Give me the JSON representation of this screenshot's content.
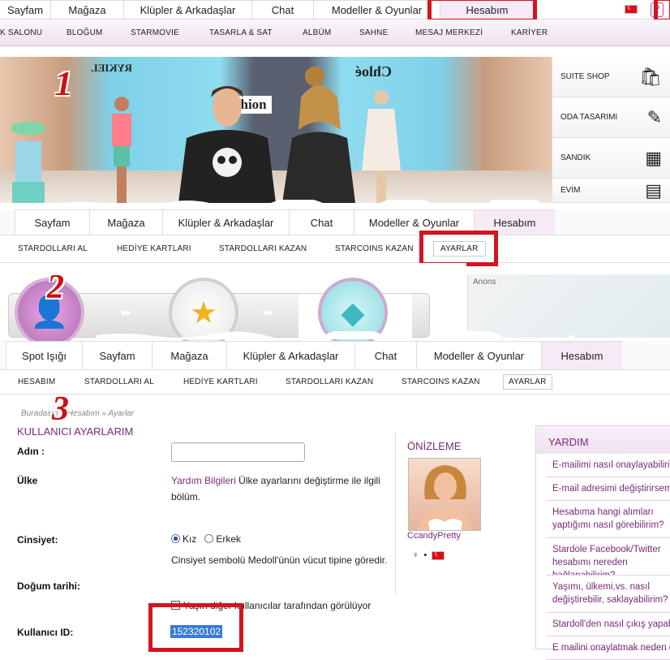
{
  "section1": {
    "tabs": [
      "Sayfam",
      "Mağaza",
      "Klüpler & Arkadaşlar",
      "Chat",
      "Modeller & Oyunlar",
      "Hesabım"
    ],
    "help_glyph": "?",
    "subnav": [
      "K SALONU",
      "BLOĞUM",
      "STARMOVIE",
      "TASARLA & SAT",
      "ALBÜM",
      "SAHNE",
      "MESAJ MERKEZİ",
      "KARİYER"
    ],
    "banner": {
      "sign_left": "RYKIEL",
      "sign_mid": "Fashion",
      "sign_right": "Chloé"
    },
    "side_menu": [
      "SUITE SHOP",
      "ODA TASARIMI",
      "SANDIK",
      "EVİM"
    ]
  },
  "section2": {
    "tabs": [
      "Sayfam",
      "Mağaza",
      "Klüpler & Arkadaşlar",
      "Chat",
      "Modeller & Oyunlar",
      "Hesabım"
    ],
    "subnav": [
      "STARDOLLARI AL",
      "HEDİYE KARTLARI",
      "STARDOLLARI KAZAN",
      "STARCOINS KAZAN",
      "AYARLAR"
    ],
    "anons": "Anons"
  },
  "section3": {
    "tabs": [
      "Spot Işığı",
      "Sayfam",
      "Mağaza",
      "Klüpler & Arkadaşlar",
      "Chat",
      "Modeller & Oyunlar",
      "Hesabım"
    ],
    "subnav": [
      "HESABIM",
      "STARDOLLARI AL",
      "HEDİYE KARTLARI",
      "STARDOLLARI KAZAN",
      "STARCOINS KAZAN",
      "AYARLAR"
    ],
    "breadcrumb": "Buradasın » Hesabım » Ayarlar",
    "title": "KULLANICI AYARLARIM",
    "fields": {
      "name_label": "Adın :",
      "country_label": "Ülke",
      "country_link": "Yardım Bilgileri",
      "country_text": "Ülke ayarlarını değiştirme ile ilgili bölüm.",
      "gender_label": "Cinsiyet:",
      "gender_female": "Kız",
      "gender_male": "Erkek",
      "gender_note": "Cinsiyet sembolü Medoll'ünün vücut tipine göredir.",
      "birth_label": "Doğum tarihi:",
      "birth_check": "Yaşın diğer kullanıcılar tarafından görülüyor",
      "uid_label": "Kullanıcı ID:",
      "uid_value": "152320102"
    },
    "preview": {
      "title": "ÖNİZLEME",
      "username": "CcandyPretty",
      "gender_symbol": "♀",
      "dot": "•"
    },
    "help": {
      "title": "YARDIM",
      "items": [
        "E-mailimi nasıl onaylayabilirim?",
        "E-mail adresimi değiştirirsem?",
        "Hesabıma hangi alımları yaptığımı nasıl görebilirim?",
        "Stardole Facebook/Twitter hesabımı nereden bağlanabilirim?",
        "Yaşımı, ülkemi,vs. nasıl değiştirebilir, saklayabilirim?",
        "Stardoll'den nasıl çıkış yapabilirim?",
        "E mailini onaylatmak neden önemli?"
      ]
    }
  },
  "annotations": [
    "1",
    "2",
    "3"
  ],
  "colors": {
    "accent": "#7a2a7a",
    "highlight": "#d4141f",
    "selection": "#3a7bd5"
  }
}
